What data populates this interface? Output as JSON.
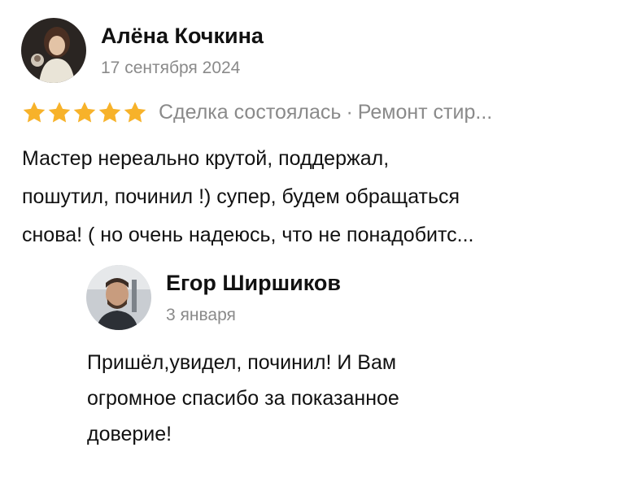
{
  "review": {
    "author": "Алёна Кочкина",
    "date": "17 сентября 2024",
    "rating": 5,
    "star_color": "#f7b22a",
    "status": "Сделка состоялась",
    "separator": "·",
    "service": "Ремонт стир...",
    "text_lines": [
      "Мастер нереально крутой, поддержал,",
      "пошутил, починил !) супер, будем обращаться",
      "снова! ( но очень надеюсь, что не понадобитс..."
    ]
  },
  "reply": {
    "author": "Егор Ширшиков",
    "date": "3 января",
    "text_lines": [
      "Пришёл,увидел, починил! И Вам",
      "огромное спасибо за показанное",
      "доверие!"
    ]
  }
}
